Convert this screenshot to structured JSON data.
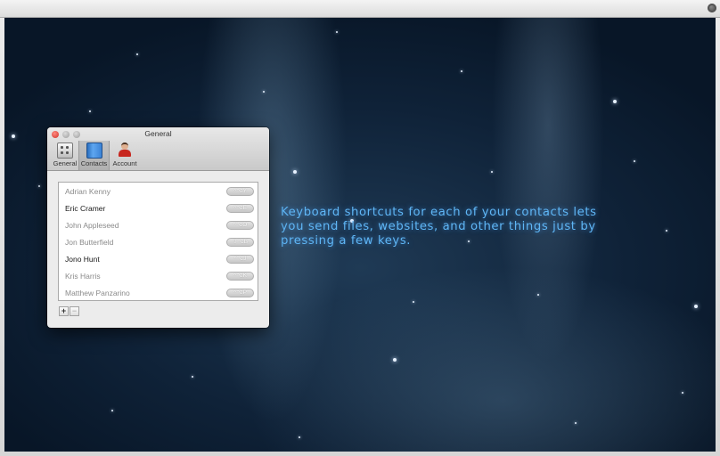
{
  "window": {
    "title": "General"
  },
  "tabs": [
    {
      "label": "General",
      "icon": "gear-icon"
    },
    {
      "label": "Contacts",
      "icon": "address-book-icon",
      "selected": true
    },
    {
      "label": "Account",
      "icon": "user-icon"
    }
  ],
  "contacts": [
    {
      "name": "Adrian Kenny",
      "shortcut": "^⌥Y",
      "emphasis": false
    },
    {
      "name": "Eric Cramer",
      "shortcut": "^⌥E",
      "emphasis": true
    },
    {
      "name": "John Appleseed",
      "shortcut": "^⌥O",
      "emphasis": false
    },
    {
      "name": "Jon Butterfield",
      "shortcut": "⇧⌥B",
      "emphasis": false
    },
    {
      "name": "Jono Hunt",
      "shortcut": "^⌥J",
      "emphasis": true
    },
    {
      "name": "Kris Harris",
      "shortcut": "^⌥K",
      "emphasis": false
    },
    {
      "name": "Matthew Panzarino",
      "shortcut": "^⌥P",
      "emphasis": false
    }
  ],
  "list_controls": {
    "add_label": "+",
    "remove_label": "−"
  },
  "promo": {
    "text": "Keyboard shortcuts for each of your contacts lets you send files, websites, and other things just by pressing a few keys."
  },
  "colors": {
    "promo_text": "#5fb6f5",
    "close_button": "#d0322a",
    "contacts_icon": "#3b83d6"
  }
}
